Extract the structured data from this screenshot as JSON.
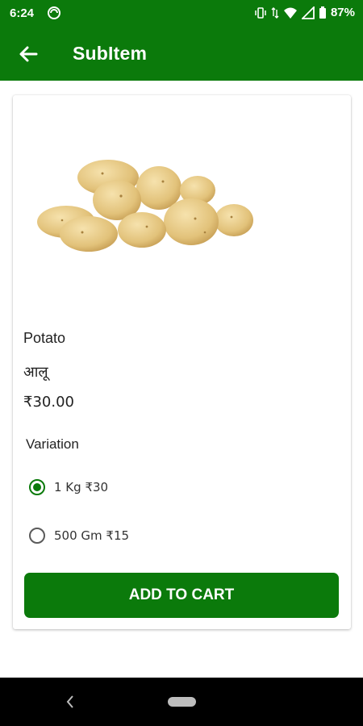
{
  "status_bar": {
    "time": "6:24",
    "battery": "87%"
  },
  "app_bar": {
    "title": "SubItem"
  },
  "product": {
    "name": "Potato",
    "name_hindi": "आलू",
    "price": "₹30.00",
    "image_icon": "potato-image"
  },
  "variation": {
    "label": "Variation",
    "options": [
      {
        "label": "1 Kg ₹30",
        "selected": true
      },
      {
        "label": "500 Gm ₹15",
        "selected": false
      }
    ]
  },
  "cart_button": {
    "label": "ADD TO CART"
  },
  "colors": {
    "primary": "#0b7a0b",
    "nav": "#000000"
  }
}
